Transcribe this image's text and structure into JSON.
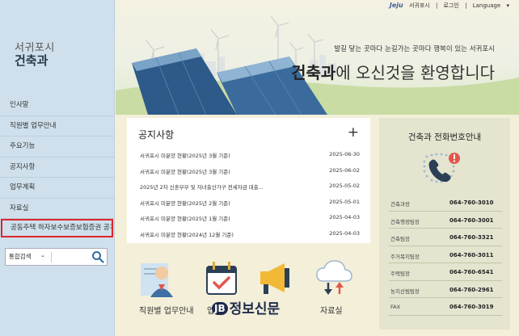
{
  "header": {
    "logo": "Jeju",
    "site_name": "서귀포시",
    "login": "로그인",
    "language": "Language",
    "slogan": "발길 닿는 곳마다 눈길가는 곳마다 행복이 있는 서귀포시",
    "welcome_bold": "건축과",
    "welcome_rest": "에 오신것을 환영합니다"
  },
  "sidebar": {
    "city": "서귀포시",
    "department": "건축과",
    "items": [
      {
        "label": "인사말"
      },
      {
        "label": "직원별 업무안내"
      },
      {
        "label": "주요기능"
      },
      {
        "label": "공지사항"
      },
      {
        "label": "업무계획"
      },
      {
        "label": "자료실"
      },
      {
        "label": "공동주택 하자보수보증보험증권 공개"
      }
    ],
    "search": {
      "select_label": "통합검색"
    }
  },
  "notice": {
    "title": "공지사항",
    "items": [
      {
        "title": "서귀포시 미분양 현황(2025년 3월 기준)",
        "date": "2025-06-30"
      },
      {
        "title": "서귀포시 미분양 현황(2025년 3월 기준)",
        "date": "2025-06-02"
      },
      {
        "title": "2025년 2차 신혼부부 및 자녀출산가구 전세자금 대출...",
        "date": "2025-05-02"
      },
      {
        "title": "서귀포시 미분양 현황(2025년 2월 기준)",
        "date": "2025-05-01"
      },
      {
        "title": "서귀포시 미분양 현황(2025년 1월 기준)",
        "date": "2025-04-03"
      },
      {
        "title": "서귀포시 미분양 현황(2024년 12월 기준)",
        "date": "2025-04-03"
      }
    ]
  },
  "phone": {
    "title": "건축과 전화번호안내",
    "items": [
      {
        "name": "건축과장",
        "number": "064-760-3010"
      },
      {
        "name": "건축행정팀장",
        "number": "064-760-3001"
      },
      {
        "name": "건축팀장",
        "number": "064-760-3321"
      },
      {
        "name": "주거복지팀장",
        "number": "064-760-3011"
      },
      {
        "name": "주택팀장",
        "number": "064-760-6541"
      },
      {
        "name": "농지산림팀장",
        "number": "064-760-2961"
      },
      {
        "name": "FAX",
        "number": "064-760-3019"
      }
    ]
  },
  "quick": {
    "staff": "직원별 업무안내",
    "task": "업",
    "data": "자료실"
  },
  "watermark": {
    "jb": "JB",
    "text": "정보신문"
  },
  "colors": {
    "highlight": "#e0232c",
    "sidebar_bg": "#cfe0ec",
    "page_bg": "#f3efd9"
  }
}
